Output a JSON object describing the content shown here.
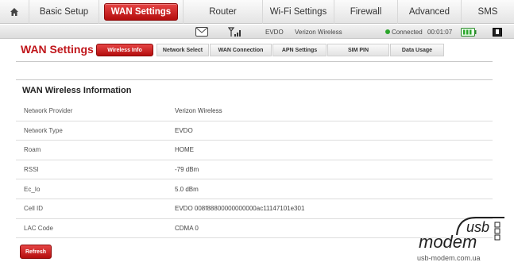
{
  "nav": {
    "items": [
      {
        "label": "Basic Setup"
      },
      {
        "label": "WAN Settings"
      },
      {
        "label": "Router"
      },
      {
        "label": "Wi-Fi Settings"
      },
      {
        "label": "Firewall"
      },
      {
        "label": "Advanced"
      },
      {
        "label": "SMS"
      }
    ]
  },
  "status": {
    "network": "EVDO",
    "provider": "Verizon Wireless",
    "connection": "Connected",
    "timer": "00:01:07"
  },
  "page": {
    "title": "WAN Settings",
    "tabs": [
      {
        "label": "Wireless Info"
      },
      {
        "label": "Network Select"
      },
      {
        "label": "WAN Connection"
      },
      {
        "label": "APN Settings"
      },
      {
        "label": "SIM PIN"
      },
      {
        "label": "Data Usage"
      }
    ]
  },
  "section": {
    "title": "WAN Wireless Information",
    "rows": [
      {
        "label": "Network Provider",
        "value": "Verizon Wireless"
      },
      {
        "label": "Network Type",
        "value": "EVDO"
      },
      {
        "label": "Roam",
        "value": "HOME"
      },
      {
        "label": "RSSI",
        "value": "-79 dBm"
      },
      {
        "label": "Ec_Io",
        "value": "5.0 dBm"
      },
      {
        "label": "Cell ID",
        "value": "EVDO 008f88800000000000ac11147101e301"
      },
      {
        "label": "LAC Code",
        "value": "CDMA 0"
      }
    ]
  },
  "refresh_label": "Refresh",
  "watermark": {
    "logo_text": "usb modem",
    "url": "usb-modem.com.ua"
  },
  "colors": {
    "accent": "#c0161b",
    "connected": "#2aa52a"
  },
  "icons": [
    "home-icon",
    "sms-envelope-icon",
    "signal-strength-icon",
    "connected-dot-icon",
    "battery-icon",
    "device-icon"
  ]
}
